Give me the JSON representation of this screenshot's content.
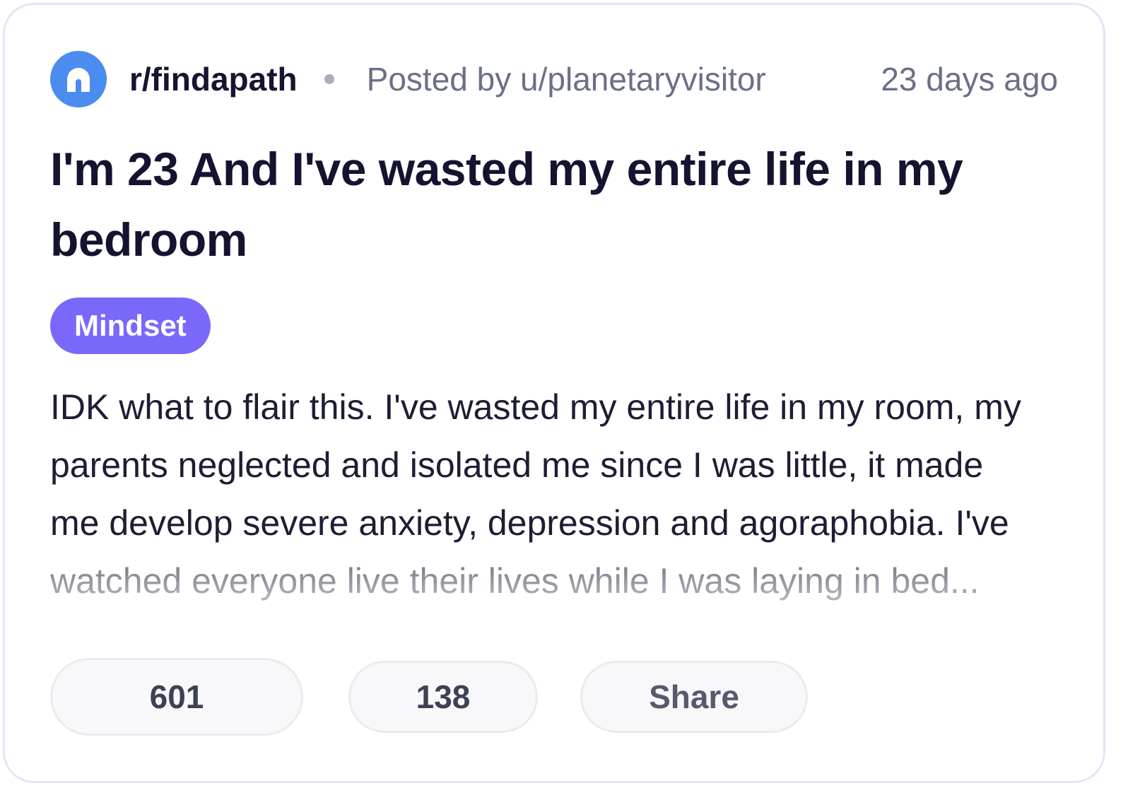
{
  "post": {
    "subreddit": "r/findapath",
    "posted_by": "Posted by u/planetaryvisitor",
    "time_ago": "23 days ago",
    "title": "I'm 23 And I've wasted my entire life in my bedroom",
    "flair": "Mindset",
    "body": "IDK what to flair this. I've wasted my entire life in my room, my parents neglected and isolated me since I was little, it made me develop severe anxiety, depression and agoraphobia. I've watched everyone live their lives while I was laying in bed..."
  },
  "actions": {
    "upvotes": "601",
    "comments": "138",
    "share_label": "Share"
  },
  "colors": {
    "avatar": "#4a8cf0",
    "flair": "#7a68fb",
    "title": "#141430",
    "meta": "#6b6f86",
    "border": "#e6e3f8"
  },
  "icons": {
    "avatar": "subreddit-avatar-icon"
  }
}
